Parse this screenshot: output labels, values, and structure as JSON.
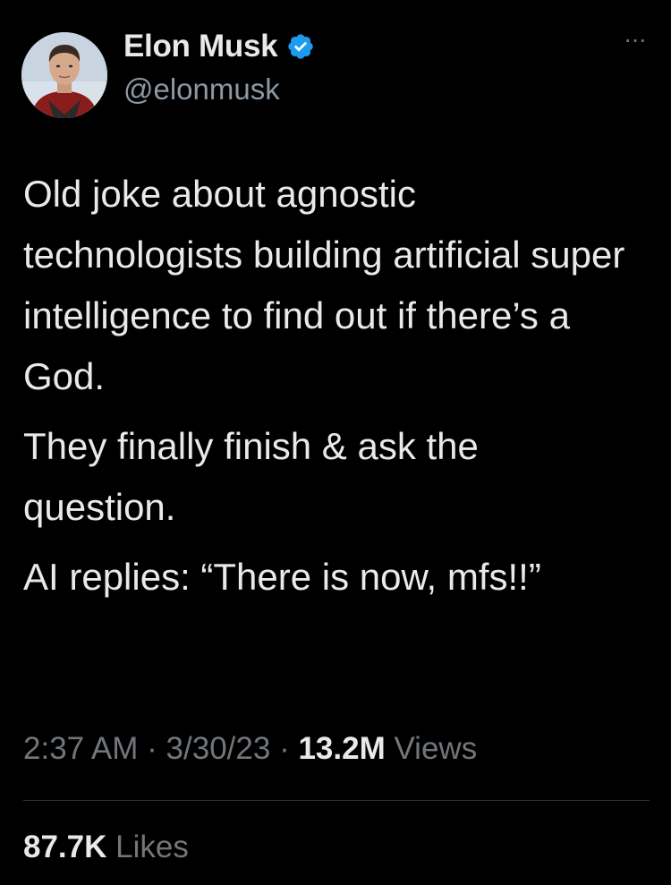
{
  "author": {
    "display_name": "Elon Musk",
    "handle": "@elonmusk",
    "verified": true,
    "verified_color": "#1d9bf0"
  },
  "more_label": "···",
  "tweet": {
    "paragraphs": [
      "Old joke about agnostic technologists building artificial super intelligence to find out if there’s a God.",
      "They finally finish & ask the question.",
      "AI replies: “There is now, mfs!!”"
    ]
  },
  "meta": {
    "time": "2:37 AM",
    "separator": "·",
    "date": "3/30/23",
    "views_count": "13.2M",
    "views_label": "Views"
  },
  "stats": {
    "likes_count": "87.7K",
    "likes_label": "Likes"
  },
  "colors": {
    "background": "#000000",
    "text": "#e7e9ea",
    "secondary": "#71767b",
    "divider": "#2f3336"
  }
}
